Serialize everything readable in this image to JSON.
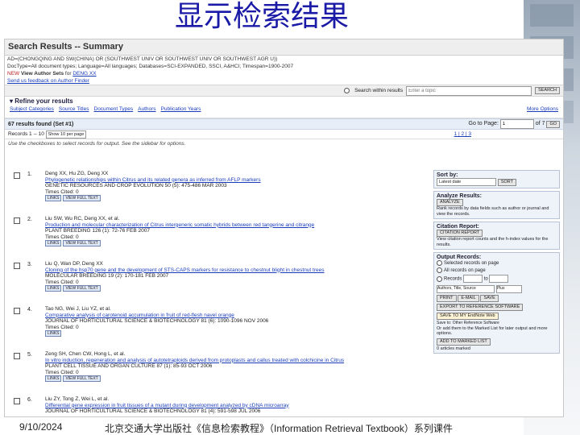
{
  "slide": {
    "title": "显示检索结果",
    "date": "9/10/2024",
    "footer": "北京交通大学出版社《信息检索教程》（Information Retrieval Textbook）系列课件"
  },
  "header": {
    "title": "Search Results -- Summary"
  },
  "query": {
    "line1": "AD=(CHONGQING AND SW(CHINA) OR (SOUTHWEST UNIV OR SOUTHWEST UNIV OR SOUTHWEST AGR U))",
    "line2": "DocType=All document types; Language=All languages; Databases=SCI-EXPANDED, SSCI, A&HCI; Timespan=1900-2007",
    "view_author_sets": "View Author Sets",
    "view_author_sets_suffix": "for",
    "author_name": "DENG XX",
    "feedback": "Send us feedback on Author Finder"
  },
  "search_within": {
    "label": "Search within results",
    "placeholder": "Enter a topic",
    "button": "SEARCH"
  },
  "refine": {
    "title": "Refine your results",
    "tabs": [
      "Subject Categories",
      "Source Titles",
      "Document Types",
      "Authors",
      "Publication Years"
    ],
    "more": "More Options"
  },
  "results_found": "67 results found (Set #1)",
  "page_nav": {
    "goto": "Go to Page:",
    "page": "1",
    "of": "of 7",
    "go": "GO"
  },
  "records": {
    "label": "Records",
    "range": "1 -- 10",
    "show": "Show 10 per page",
    "pages": "1 | 2 | 3"
  },
  "hint": "Use the checkboxes to select records for output. See the sidebar for options.",
  "btn_links": "LINKS",
  "btn_fulltext": "VIEW FULL TEXT",
  "results": [
    {
      "num": "1.",
      "authors": "Deng XX, Hu ZG, Deng XX",
      "title": "Phylogenetic relationships within Citrus and its related genera as inferred from AFLP markers",
      "source": "GENETIC RESOURCES AND CROP EVOLUTION 50 (5): 475-486 MAR 2003",
      "cited": "Times Cited: 0",
      "fulltext": true
    },
    {
      "num": "2.",
      "authors": "Liu SW, Wu RC, Deng XX, et al.",
      "title": "Production and molecular characterization of Citrus intergeneric somatic hybrids between red tangerine and citrange",
      "source": "PLANT BREEDING 126 (1): 72-76 FEB 2007",
      "cited": "Times Cited: 0",
      "fulltext": true
    },
    {
      "num": "3.",
      "authors": "Liu Q, Wan DP, Deng XX",
      "title": "Cloning of the hsp70 gene and the development of STS-CAPS markers for resistance to chestnut blight in chestnut trees",
      "source": "MOLECULAR BREEDING 19 (2): 170-181 FEB 2007",
      "cited": "Times Cited: 0",
      "fulltext": true
    },
    {
      "num": "4.",
      "authors": "Tao NG, Wei J, Liu YZ, et al.",
      "title": "Comparative analysis of carotenoid accumulation in fruit of red-flesh navel orange",
      "source": "JOURNAL OF HORTICULTURAL SCIENCE & BIOTECHNOLOGY 81 (6): 1090-1096 NOV 2006",
      "cited": "Times Cited: 0",
      "fulltext": false
    },
    {
      "num": "5.",
      "authors": "Zeng SH, Chen CW, Hong L, et al.",
      "title": "In vitro induction, regeneration and analysis of autotetraploids derived from protoplasts and callus treated with colchicine in Citrus",
      "source": "PLANT CELL TISSUE AND ORGAN CULTURE 87 (1): 85-93 OCT 2006",
      "cited": "Times Cited: 0",
      "fulltext": true
    },
    {
      "num": "6.",
      "authors": "Liu ZY, Tong Z, Wei L, et al.",
      "title": "Differential gene expression in fruit tissues of a mutant during development analyzed by cDNA microarray",
      "source": "JOURNAL OF HORTICULTURAL SCIENCE & BIOTECHNOLOGY 81 (4): 591-598 JUL 2006",
      "cited": "",
      "fulltext": false
    }
  ],
  "sidebar": {
    "sort_by": "Sort by:",
    "sort_value": "Latest date",
    "sort_button": "SORT",
    "analyze_title": "Analyze Results:",
    "analyze_button": "ANALYZE",
    "analyze_desc": "Rank records by data fields such as author or journal and view the records.",
    "citation_title": "Citation Report:",
    "citation_button": "CITATION REPORT",
    "citation_desc": "View citation report counts and the h-index values for the results.",
    "output_title": "Output Records:",
    "opt_selected": "Selected records on page",
    "opt_all": "All records on page",
    "opt_records": "Records",
    "opt_to": "to",
    "field_select": "Authors, Title, Source",
    "field_more": "Plus",
    "btn_print": "PRINT",
    "btn_email": "E-MAIL",
    "btn_save": "SAVE",
    "btn_export": "EXPORT TO REFERENCE SOFTWARE",
    "btn_endnote": "SAVE TO MY EndNote Web",
    "save_to": "Save to: Other Reference Software",
    "marked_desc": "Or add them to the Marked List for later output and more options.",
    "btn_marked": "ADD TO MARKED LIST",
    "marked_count": "0 articles marked"
  }
}
